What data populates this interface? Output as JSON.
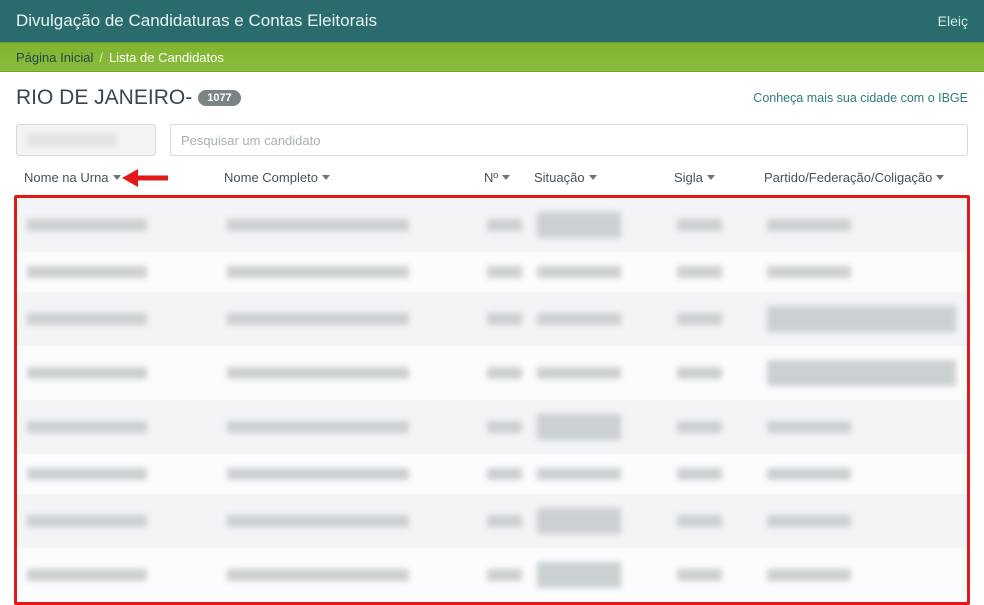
{
  "topbar": {
    "title": "Divulgação de Candidaturas e Contas Eleitorais",
    "right": "Eleiç"
  },
  "breadcrumb": {
    "home": "Página Inicial",
    "sep": "/",
    "current": "Lista de Candidatos"
  },
  "region": {
    "name": "RIO DE JANEIRO",
    "dash": " - ",
    "count": "1077"
  },
  "ibge_link": "Conheça mais sua cidade com o IBGE",
  "search": {
    "placeholder": "Pesquisar um candidato"
  },
  "columns": {
    "nome_urna": "Nome na Urna",
    "nome_completo": "Nome Completo",
    "numero": "Nº",
    "situacao": "Situação",
    "sigla": "Sigla",
    "partido": "Partido/Federação/Coligação"
  },
  "rows": [
    {
      "double_situacao": true,
      "long_partido": false
    },
    {
      "double_situacao": false,
      "long_partido": false
    },
    {
      "double_situacao": false,
      "long_partido": true
    },
    {
      "double_situacao": false,
      "long_partido": true
    },
    {
      "double_situacao": true,
      "long_partido": false
    },
    {
      "double_situacao": false,
      "long_partido": false
    },
    {
      "double_situacao": true,
      "long_partido": false
    },
    {
      "double_situacao": true,
      "long_partido": false
    }
  ]
}
